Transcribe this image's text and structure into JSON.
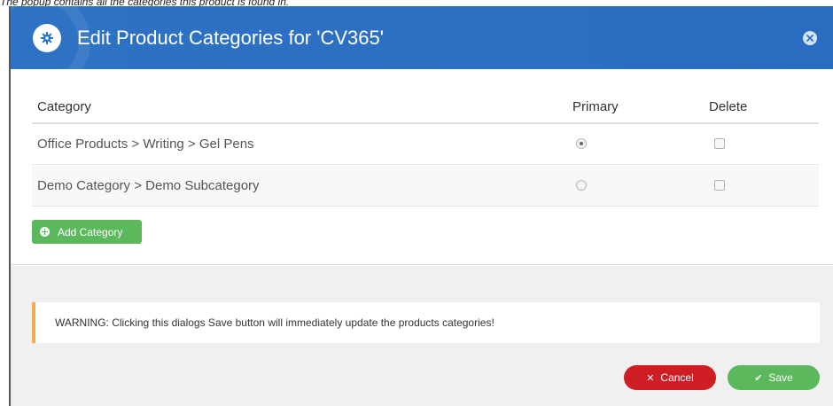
{
  "caption": "The popup contains all the categories this product is found in.",
  "dialog": {
    "title": "Edit Product Categories for 'CV365'",
    "header_icon": "gear-icon",
    "close_icon": "close-circle-icon"
  },
  "table": {
    "headers": {
      "category": "Category",
      "primary": "Primary",
      "delete": "Delete"
    },
    "rows": [
      {
        "category": "Office Products > Writing > Gel Pens",
        "primary": true,
        "delete": false
      },
      {
        "category": "Demo Category > Demo Subcategory",
        "primary": false,
        "delete": false
      }
    ]
  },
  "buttons": {
    "add_category": "Add Category",
    "cancel": "Cancel",
    "save": "Save"
  },
  "warning": "WARNING: Clicking this dialogs Save button will immediately update the products categories!",
  "colors": {
    "header": "#2b73c6",
    "add_button": "#5cb85c",
    "cancel_button": "#cf1d24",
    "save_button": "#5cb85c",
    "warning_accent": "#f0ad4e"
  }
}
